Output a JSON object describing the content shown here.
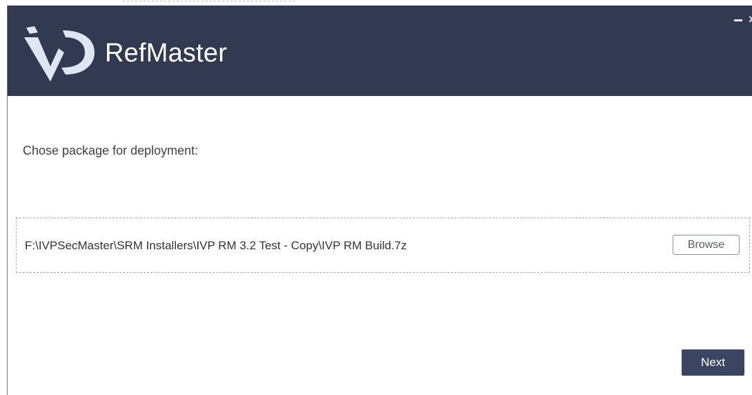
{
  "app": {
    "name": "RefMaster",
    "logo_icon": "ivp-logo-icon"
  },
  "window_controls": {
    "minimize_icon": "minimize-icon",
    "close_label": "×"
  },
  "main": {
    "prompt": "Chose package for deployment:",
    "file_path": "F:\\IVPSecMaster\\SRM Installers\\IVP RM 3.2 Test - Copy\\IVP RM Build.7z",
    "browse_label": "Browse",
    "next_label": "Next"
  },
  "colors": {
    "header_bg": "#323a52",
    "button_bg": "#3b4461",
    "logo_light": "#dfe5f2"
  }
}
